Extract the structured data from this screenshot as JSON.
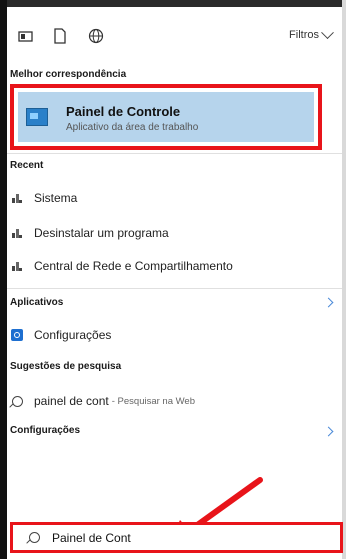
{
  "toolbar": {
    "icons": [
      "apps-icon",
      "document-icon",
      "web-icon"
    ],
    "filters_label": "Filtros"
  },
  "best_match": {
    "section_label": "Melhor correspondência",
    "title": "Painel de Controle",
    "subtitle": "Aplicativo da área de trabalho"
  },
  "recent": {
    "section_label": "Recent",
    "items": [
      {
        "label": "Sistema"
      },
      {
        "label": "Desinstalar um programa"
      },
      {
        "label": "Central de Rede e Compartilhamento"
      }
    ]
  },
  "apps": {
    "section_label": "Aplicativos",
    "items": [
      {
        "label": "Configurações"
      }
    ]
  },
  "suggestions": {
    "section_label": "Sugestões de pesquisa",
    "items": [
      {
        "query": "painel de cont",
        "suffix": "- Pesquisar na Web"
      }
    ]
  },
  "settings": {
    "section_label": "Configurações"
  },
  "search": {
    "value": "Painel de Cont"
  },
  "colors": {
    "highlight_border": "#e8141a",
    "selected_bg": "#b6d4ec",
    "accent": "#1e6fd0"
  }
}
